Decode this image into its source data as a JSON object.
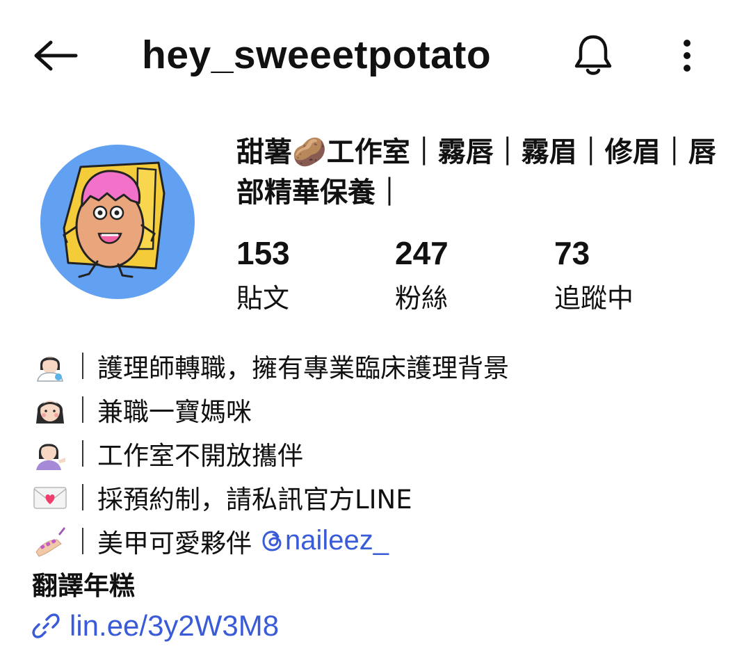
{
  "header": {
    "username": "hey_sweeetpotato",
    "back_icon": "arrow-left-icon",
    "bell_icon": "bell-icon",
    "more_icon": "more-vertical-icon"
  },
  "profile": {
    "display_name": "甜薯🥔工作室｜霧唇｜霧眉｜修眉｜唇部精華保養｜",
    "avatar": "avatar-sweet-potato-cartoon",
    "stats": {
      "posts": {
        "value": "153",
        "label": "貼文"
      },
      "followers": {
        "value": "247",
        "label": "粉絲"
      },
      "following": {
        "value": "73",
        "label": "追蹤中"
      }
    }
  },
  "bio": {
    "lines": [
      {
        "icon": "woman-health-worker-emoji",
        "text": "護理師轉職，擁有專業臨床護理背景"
      },
      {
        "icon": "woman-face-emoji",
        "text": "兼職一寶媽咪"
      },
      {
        "icon": "woman-tipping-hand-emoji",
        "text": "工作室不開放攜伴"
      },
      {
        "icon": "love-letter-emoji",
        "text": "採預約制，請私訊官方LINE"
      },
      {
        "icon": "nail-polish-emoji",
        "text": "美甲可愛夥伴",
        "mention": "naileez_",
        "mention_icon": "threads-icon"
      }
    ],
    "title": "翻譯年糕",
    "link": "lin.ee/3y2W3M8",
    "link_icon": "link-icon"
  },
  "colors": {
    "link": "#3a5bd8",
    "avatar_bg": "#62a1f1",
    "text": "#111111"
  }
}
